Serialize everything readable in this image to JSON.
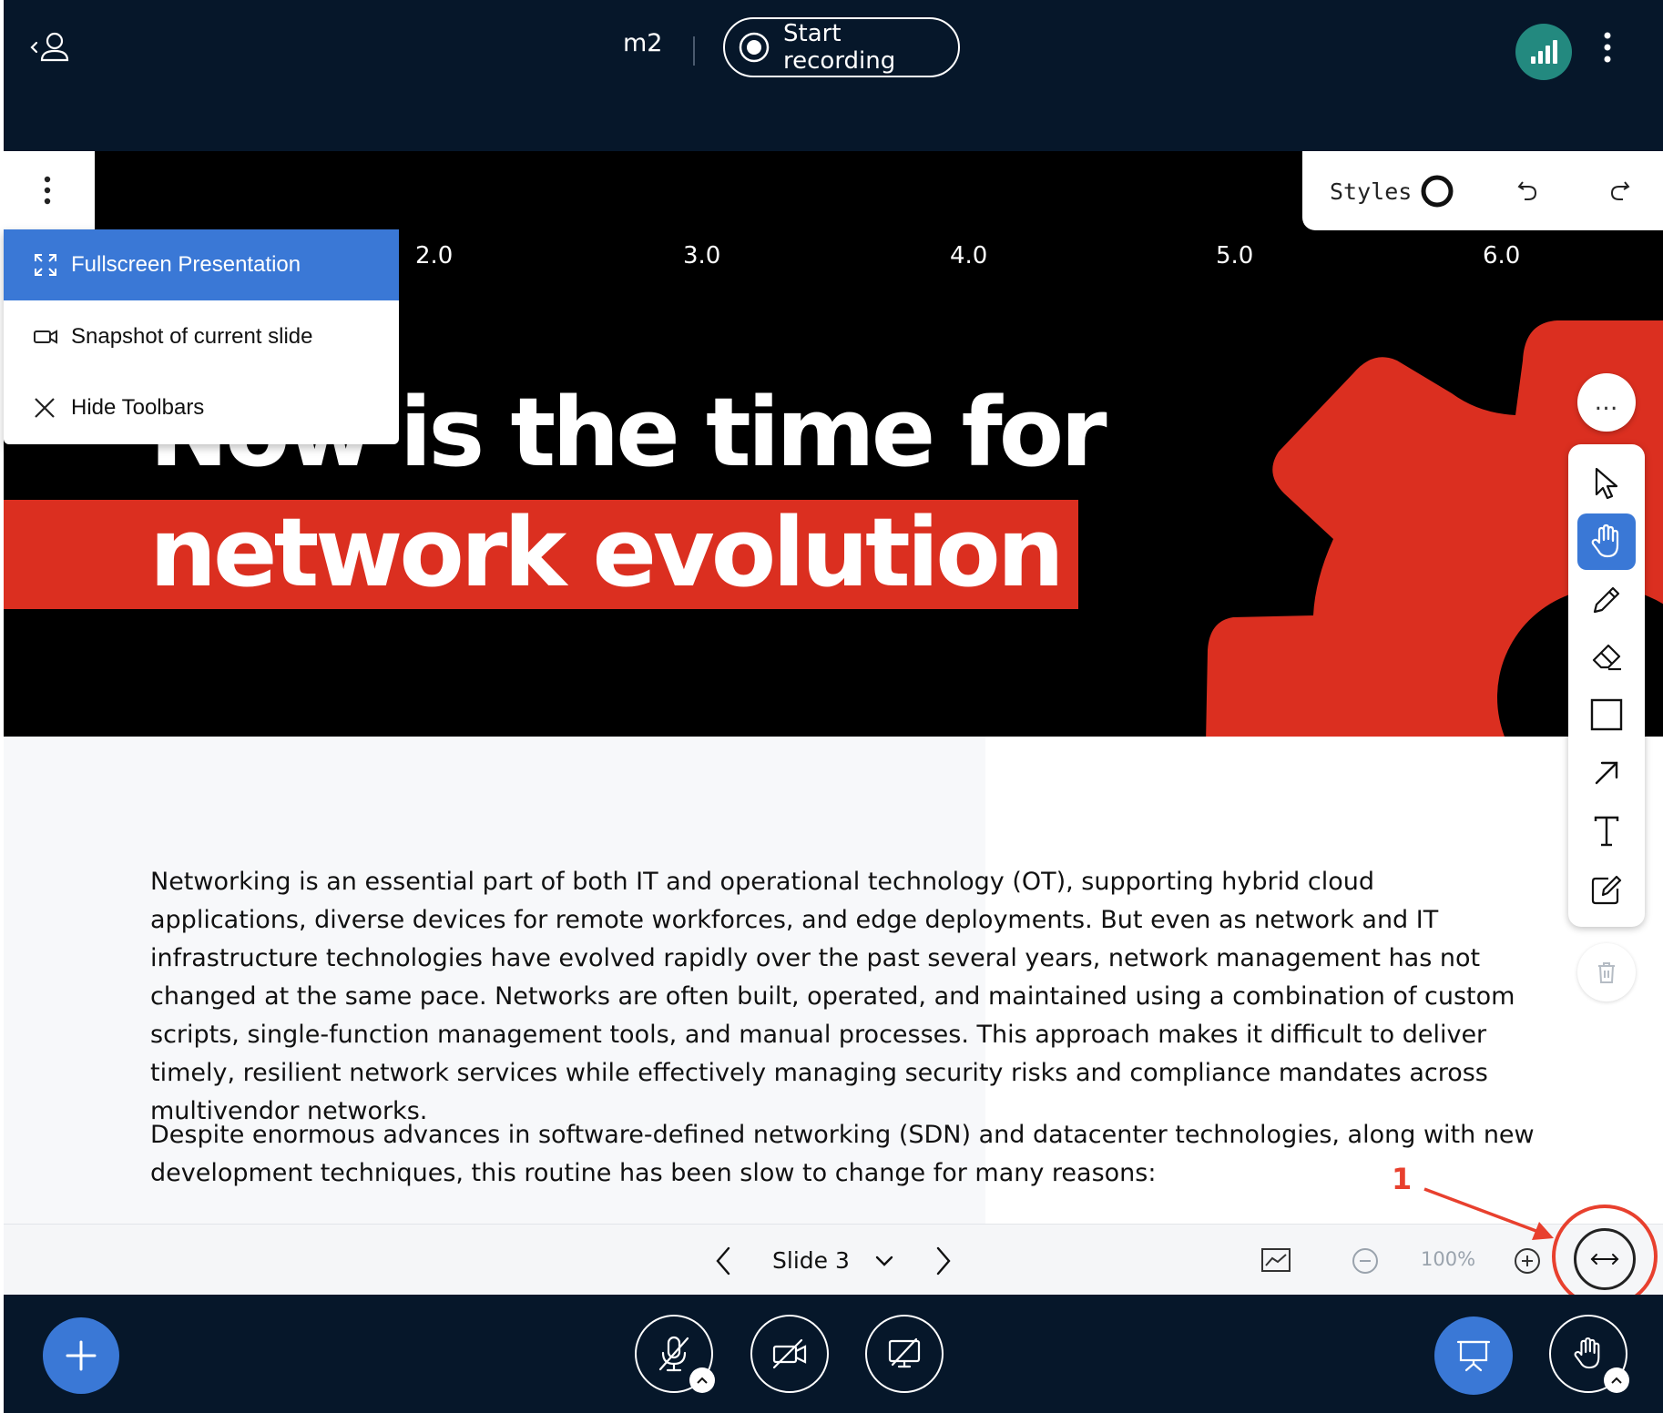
{
  "header": {
    "meeting_name": "m2",
    "record_label": "Start recording",
    "icons": [
      "user-list-toggle-icon",
      "record-icon",
      "connection-status-icon",
      "kebab-menu-icon"
    ]
  },
  "presentation_menu": {
    "items": [
      {
        "label": "Fullscreen Presentation",
        "icon": "fullscreen-icon",
        "active": true
      },
      {
        "label": "Snapshot of current slide",
        "icon": "camera-icon",
        "active": false
      },
      {
        "label": "Hide Toolbars",
        "icon": "close-icon",
        "active": false
      }
    ]
  },
  "slide": {
    "ruler": [
      "2.0",
      "3.0",
      "4.0",
      "5.0",
      "6.0"
    ],
    "headline_line1": "Now is the time for",
    "headline_line2": "network evolution",
    "accent_color": "#db2f20"
  },
  "styles_panel": {
    "label": "Styles",
    "icons": [
      "stroke-style-icon",
      "undo-icon",
      "redo-icon"
    ]
  },
  "whiteboard_tools": {
    "items": [
      "select-icon",
      "pan-hand-icon",
      "pencil-icon",
      "eraser-icon",
      "rectangle-icon",
      "arrow-icon",
      "text-icon",
      "note-icon"
    ],
    "active": "pan-hand-icon",
    "more_label": "…",
    "delete_icon": "trash-icon"
  },
  "document": {
    "paragraph1": "Networking is an essential part of both IT and operational technology (OT), supporting hybrid cloud applications, diverse devices for remote workforces, and edge deployments. But even as network and IT infrastructure technologies have evolved rapidly over the past several years, network management has not changed at the same pace. Networks are often built, operated, and maintained using a combination of custom scripts, single-function management tools, and manual processes. This approach makes it difficult to deliver timely, resilient network services while effectively managing security risks and compliance mandates across multivendor networks.",
    "paragraph2": "Despite enormous advances in software-defined networking (SDN) and datacenter technologies, along with new development techniques, this routine has been slow to change for many reasons:"
  },
  "slide_nav": {
    "slide_label": "Slide 3",
    "zoom": "100%",
    "icons": [
      "prev-slide-icon",
      "slide-select-chevron-icon",
      "next-slide-icon",
      "multi-user-whiteboard-icon",
      "zoom-out-icon",
      "zoom-in-icon",
      "fit-to-width-icon"
    ]
  },
  "annotation": {
    "number": "1",
    "color": "#e8402e"
  },
  "bottom_controls": {
    "icons": [
      "actions-plus-icon",
      "mic-muted-icon",
      "camera-off-icon",
      "screenshare-off-icon",
      "presentation-icon",
      "raise-hand-icon"
    ],
    "primary_color": "#3a78d6"
  }
}
